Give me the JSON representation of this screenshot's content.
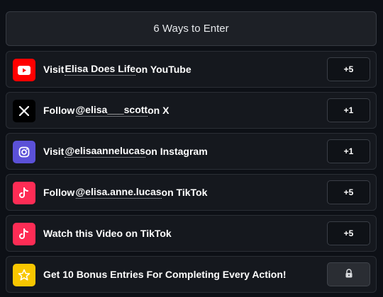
{
  "header": {
    "title": "6 Ways to Enter"
  },
  "entries": [
    {
      "icon": "youtube-icon",
      "color": "#ff0000",
      "prefix": "Visit ",
      "link": "Elisa Does Life",
      "suffix": " on YouTube",
      "points": "+5"
    },
    {
      "icon": "x-icon",
      "color": "#000000",
      "prefix": "Follow ",
      "link": "@elisa___scott",
      "suffix": " on X",
      "points": "+1"
    },
    {
      "icon": "instagram-icon",
      "color": "#5b51d8",
      "prefix": "Visit ",
      "link": "@elisaannelucas",
      "suffix": " on Instagram",
      "points": "+1"
    },
    {
      "icon": "tiktok-icon",
      "color": "#fe2c55",
      "prefix": "Follow ",
      "link": "@elisa.anne.lucas",
      "suffix": " on TikTok",
      "points": "+5"
    },
    {
      "icon": "tiktok-icon",
      "color": "#fe2c55",
      "prefix": "Watch this Video on TikTok",
      "link": "",
      "suffix": "",
      "points": "+5"
    },
    {
      "icon": "star-icon",
      "color": "#f8c600",
      "prefix": "Get 10 Bonus Entries For Completing Every Action!",
      "link": "",
      "suffix": "",
      "points_icon": "lock-icon"
    }
  ]
}
